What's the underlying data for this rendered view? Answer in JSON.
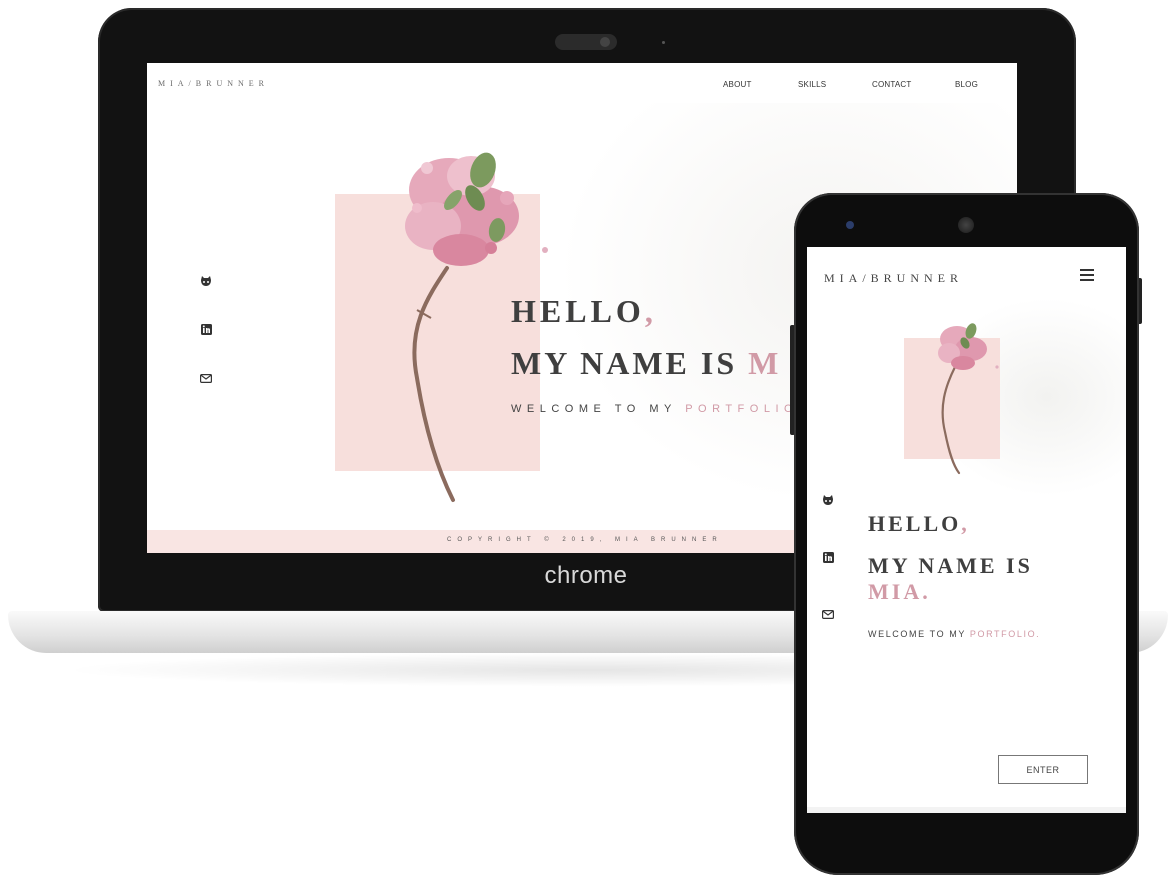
{
  "laptop": {
    "brand_label": "chrome",
    "site": {
      "logo": "MIA/BRUNNER",
      "nav": [
        "ABOUT",
        "SKILLS",
        "CONTACT",
        "BLOG"
      ],
      "social_icons": [
        "github-icon",
        "linkedin-icon",
        "mail-icon"
      ],
      "hero": {
        "hello": "HELLO",
        "hello_comma": ",",
        "name_prefix": "MY NAME IS ",
        "name_visible": "M",
        "welcome_prefix": "WELCOME TO MY ",
        "welcome_accent": "PORTFOLIO."
      },
      "footer": "COPYRIGHT © 2019, MIA BRUNNER"
    }
  },
  "phone": {
    "site": {
      "logo": "MIA/BRUNNER",
      "menu_icon": "hamburger-icon",
      "social_icons": [
        "github-icon",
        "linkedin-icon",
        "mail-icon"
      ],
      "hero": {
        "hello": "HELLO",
        "hello_comma": ",",
        "name_line1": "MY NAME IS",
        "name_line2": "MIA.",
        "welcome_prefix": "WELCOME TO MY ",
        "welcome_accent": "PORTFOLIO."
      },
      "enter_button": "ENTER"
    }
  },
  "colors": {
    "accent": "#d19aa6",
    "pink_panel": "#f7dfdc",
    "footer_pink": "#f9e5e3",
    "text_dark": "#3f3f3f",
    "bezel": "#121212"
  }
}
